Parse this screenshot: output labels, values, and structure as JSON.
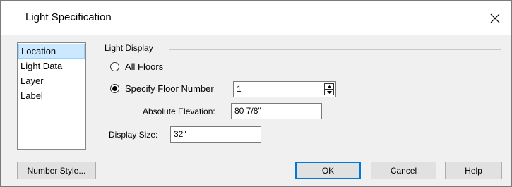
{
  "dialog": {
    "title": "Light Specification"
  },
  "nav": {
    "items": [
      {
        "label": "Location"
      },
      {
        "label": "Light Data"
      },
      {
        "label": "Layer"
      },
      {
        "label": "Label"
      }
    ],
    "selected": "Location"
  },
  "light_display": {
    "group_label": "Light Display",
    "all_floors_label": "All Floors",
    "all_floors_checked": false,
    "specify_floor_label": "Specify Floor Number",
    "specify_floor_checked": true,
    "floor_number_value": "1",
    "absolute_elevation_label": "Absolute Elevation:",
    "absolute_elevation_value": "80 7/8\"",
    "display_size_label": "Display Size:",
    "display_size_value": "32\""
  },
  "buttons": {
    "number_style": "Number Style...",
    "ok": "OK",
    "cancel": "Cancel",
    "help": "Help"
  },
  "colors": {
    "selection_bg": "#cce8ff",
    "default_button_border": "#0078d7",
    "dialog_bg": "#f0f0f0"
  },
  "icons": {
    "close": "close-icon",
    "spin_up": "chevron-up-icon",
    "spin_down": "chevron-down-icon"
  }
}
